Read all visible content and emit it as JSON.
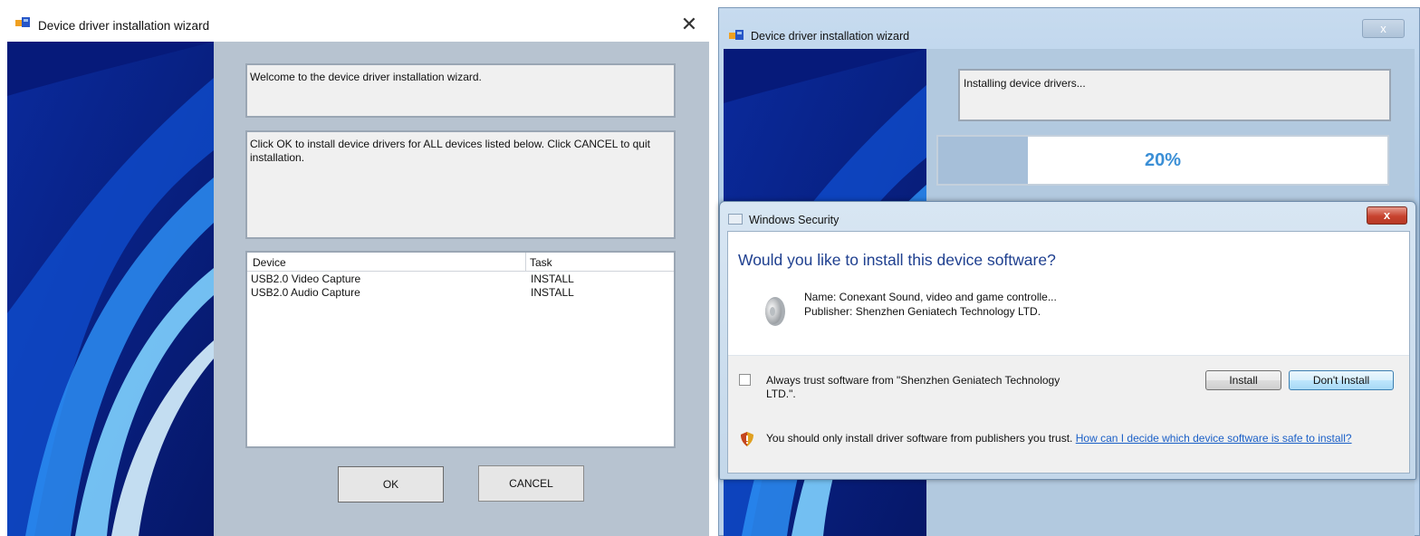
{
  "left_window": {
    "title": "Device driver installation wizard",
    "close_glyph": "✕",
    "welcome_text": "Welcome to the device driver installation wizard.",
    "instruction_text": "Click OK to install device drivers for ALL devices listed below. Click CANCEL to quit installation.",
    "columns": [
      "Device",
      "Task"
    ],
    "rows": [
      {
        "device": "USB2.0 Video Capture",
        "task": "INSTALL"
      },
      {
        "device": "USB2.0 Audio Capture",
        "task": "INSTALL"
      }
    ],
    "ok_label": "OK",
    "cancel_label": "CANCEL"
  },
  "right_window": {
    "title": "Device driver installation wizard",
    "close_glyph": "x",
    "status_text": "Installing device drivers...",
    "progress_fraction": 0.2,
    "progress_label": "20%"
  },
  "security_dialog": {
    "title": "Windows Security",
    "close_glyph": "x",
    "question": "Would you like to install this device software?",
    "name_line": "Name: Conexant Sound, video and game controlle...",
    "publisher_line": "Publisher: Shenzhen Geniatech Technology LTD.",
    "checkbox_label": "Always trust software from \"Shenzhen Geniatech Technology LTD.\".",
    "install_label": "Install",
    "dont_install_label": "Don't Install",
    "warning_text": "You should only install driver software from publishers you trust.",
    "help_link": "How can I decide which device software is safe to install?"
  },
  "icons": [
    "app-icon",
    "close-icon",
    "speaker-icon",
    "shield-icon"
  ],
  "colors": {
    "progress_text": "#3b8fd6",
    "question_text": "#1e3f8f",
    "link": "#1a5fc7",
    "banner": "#0a1f8a"
  }
}
